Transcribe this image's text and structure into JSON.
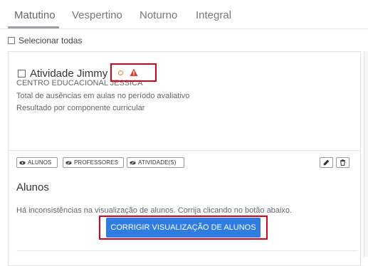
{
  "tabs": [
    "Matutino",
    "Vespertino",
    "Noturno",
    "Integral"
  ],
  "select_all_label": "Selecionar todas",
  "card": {
    "title": "Atividade Jimmy",
    "school": "CENTRO EDUCACIONAL JESSICA",
    "line1": "Total de ausências em aulas no período avaliativo",
    "line2": "Resultado por componente curricular",
    "buttons": {
      "alunos": "ALUNOS",
      "professores": "PROFESSORES",
      "atividades": "ATIVIDADE(S)"
    },
    "section_title": "Alunos",
    "message": "Há inconsistências na visualização de alunos. Corrija clicando no botão abaixo.",
    "fix_button": "CORRIGIR VISUALIZAÇÃO DE ALUNOS"
  },
  "icons": {
    "status_circle": "circle-outline-icon",
    "warning": "warning-triangle-icon",
    "edit": "pencil-icon",
    "delete": "trash-icon",
    "view": "eye-icon",
    "hidden": "eye-slash-icon"
  },
  "colors": {
    "primary": "#2f7de0",
    "highlight_box": "#d6001c",
    "warning": "#e23b2e",
    "status_circle": "#e48a2e"
  }
}
